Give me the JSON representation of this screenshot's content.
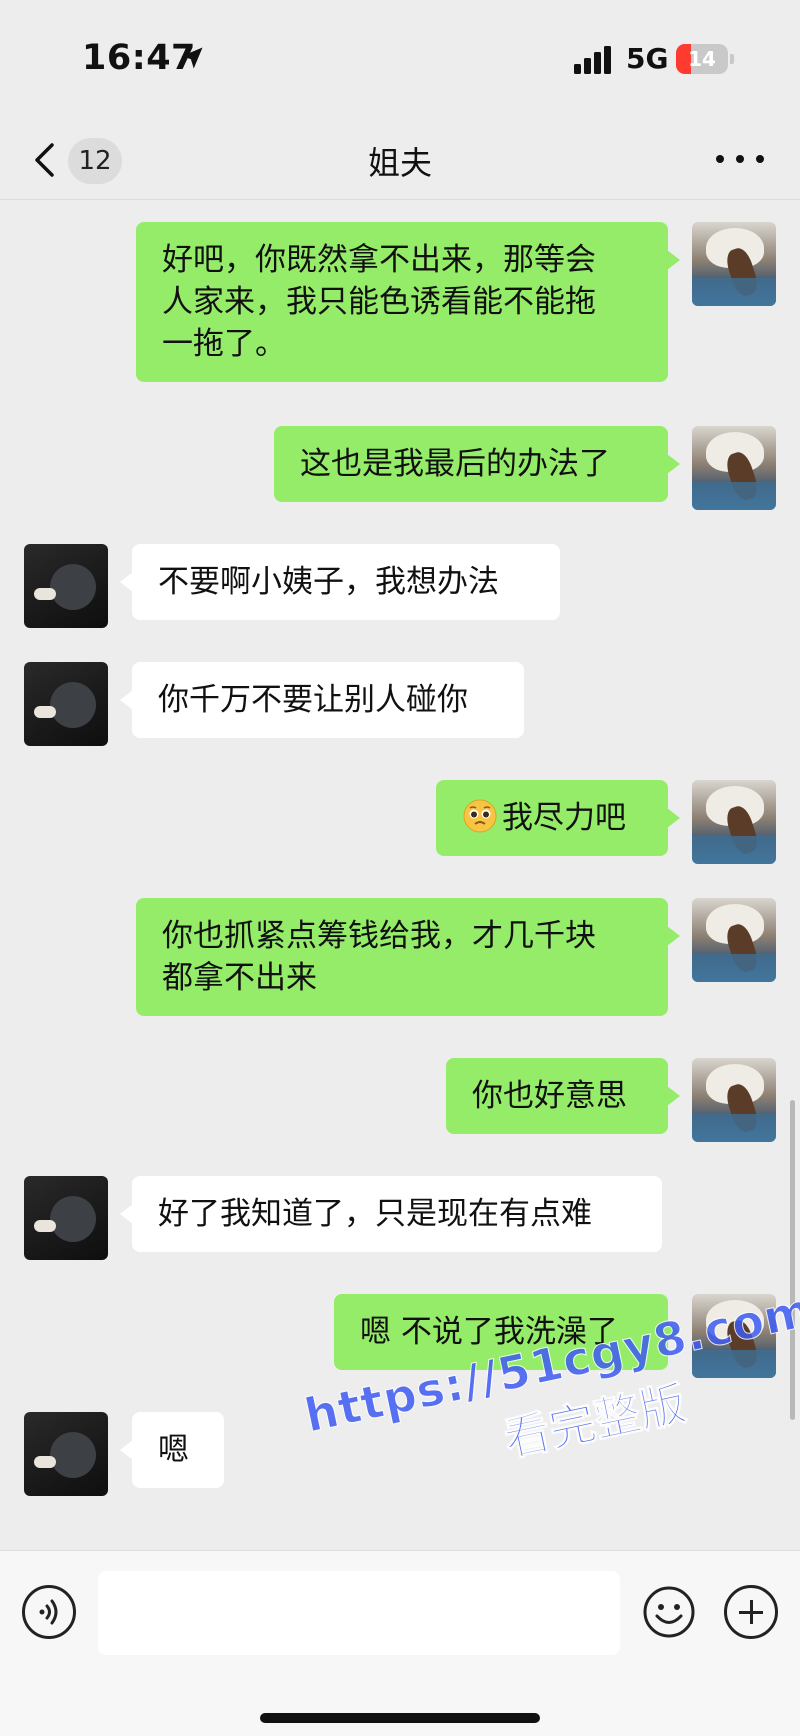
{
  "status_bar": {
    "time": "16:47",
    "network": "5G",
    "battery": "14",
    "battery_color": "#ff3b30"
  },
  "nav": {
    "unread_count": "12",
    "title": "姐夫",
    "more_icon": "more-dots-icon",
    "back_icon": "chevron-left-icon"
  },
  "colors": {
    "my_bubble": "#95ec69",
    "their_bubble": "#ffffff",
    "background": "#ededed",
    "watermark": "#3d5bf2"
  },
  "messages": [
    {
      "from": "me",
      "lines": [
        "好吧，你既然拿不出来，那等会",
        "人家来，我只能色诱看能不能拖",
        "一拖了。"
      ]
    },
    {
      "from": "me",
      "text": "这也是我最后的办法了"
    },
    {
      "from": "them",
      "text": "不要啊小姨子，我想办法"
    },
    {
      "from": "them",
      "text": "你千万不要让别人碰你"
    },
    {
      "from": "me",
      "emoji": "pleading-face-icon",
      "text": "我尽力吧"
    },
    {
      "from": "me",
      "lines": [
        "你也抓紧点筹钱给我，才几千块",
        "都拿不出来"
      ]
    },
    {
      "from": "me",
      "text": "你也好意思"
    },
    {
      "from": "them",
      "text": "好了我知道了，只是现在有点难"
    },
    {
      "from": "me",
      "text": "嗯 不说了我洗澡了"
    },
    {
      "from": "them",
      "text": "嗯"
    }
  ],
  "watermark": {
    "url": "https://51cgy8.com",
    "subtitle": "看完整版"
  },
  "input_bar": {
    "voice_icon": "voice-icon",
    "emoji_icon": "smile-icon",
    "plus_icon": "plus-icon",
    "input_value": ""
  }
}
